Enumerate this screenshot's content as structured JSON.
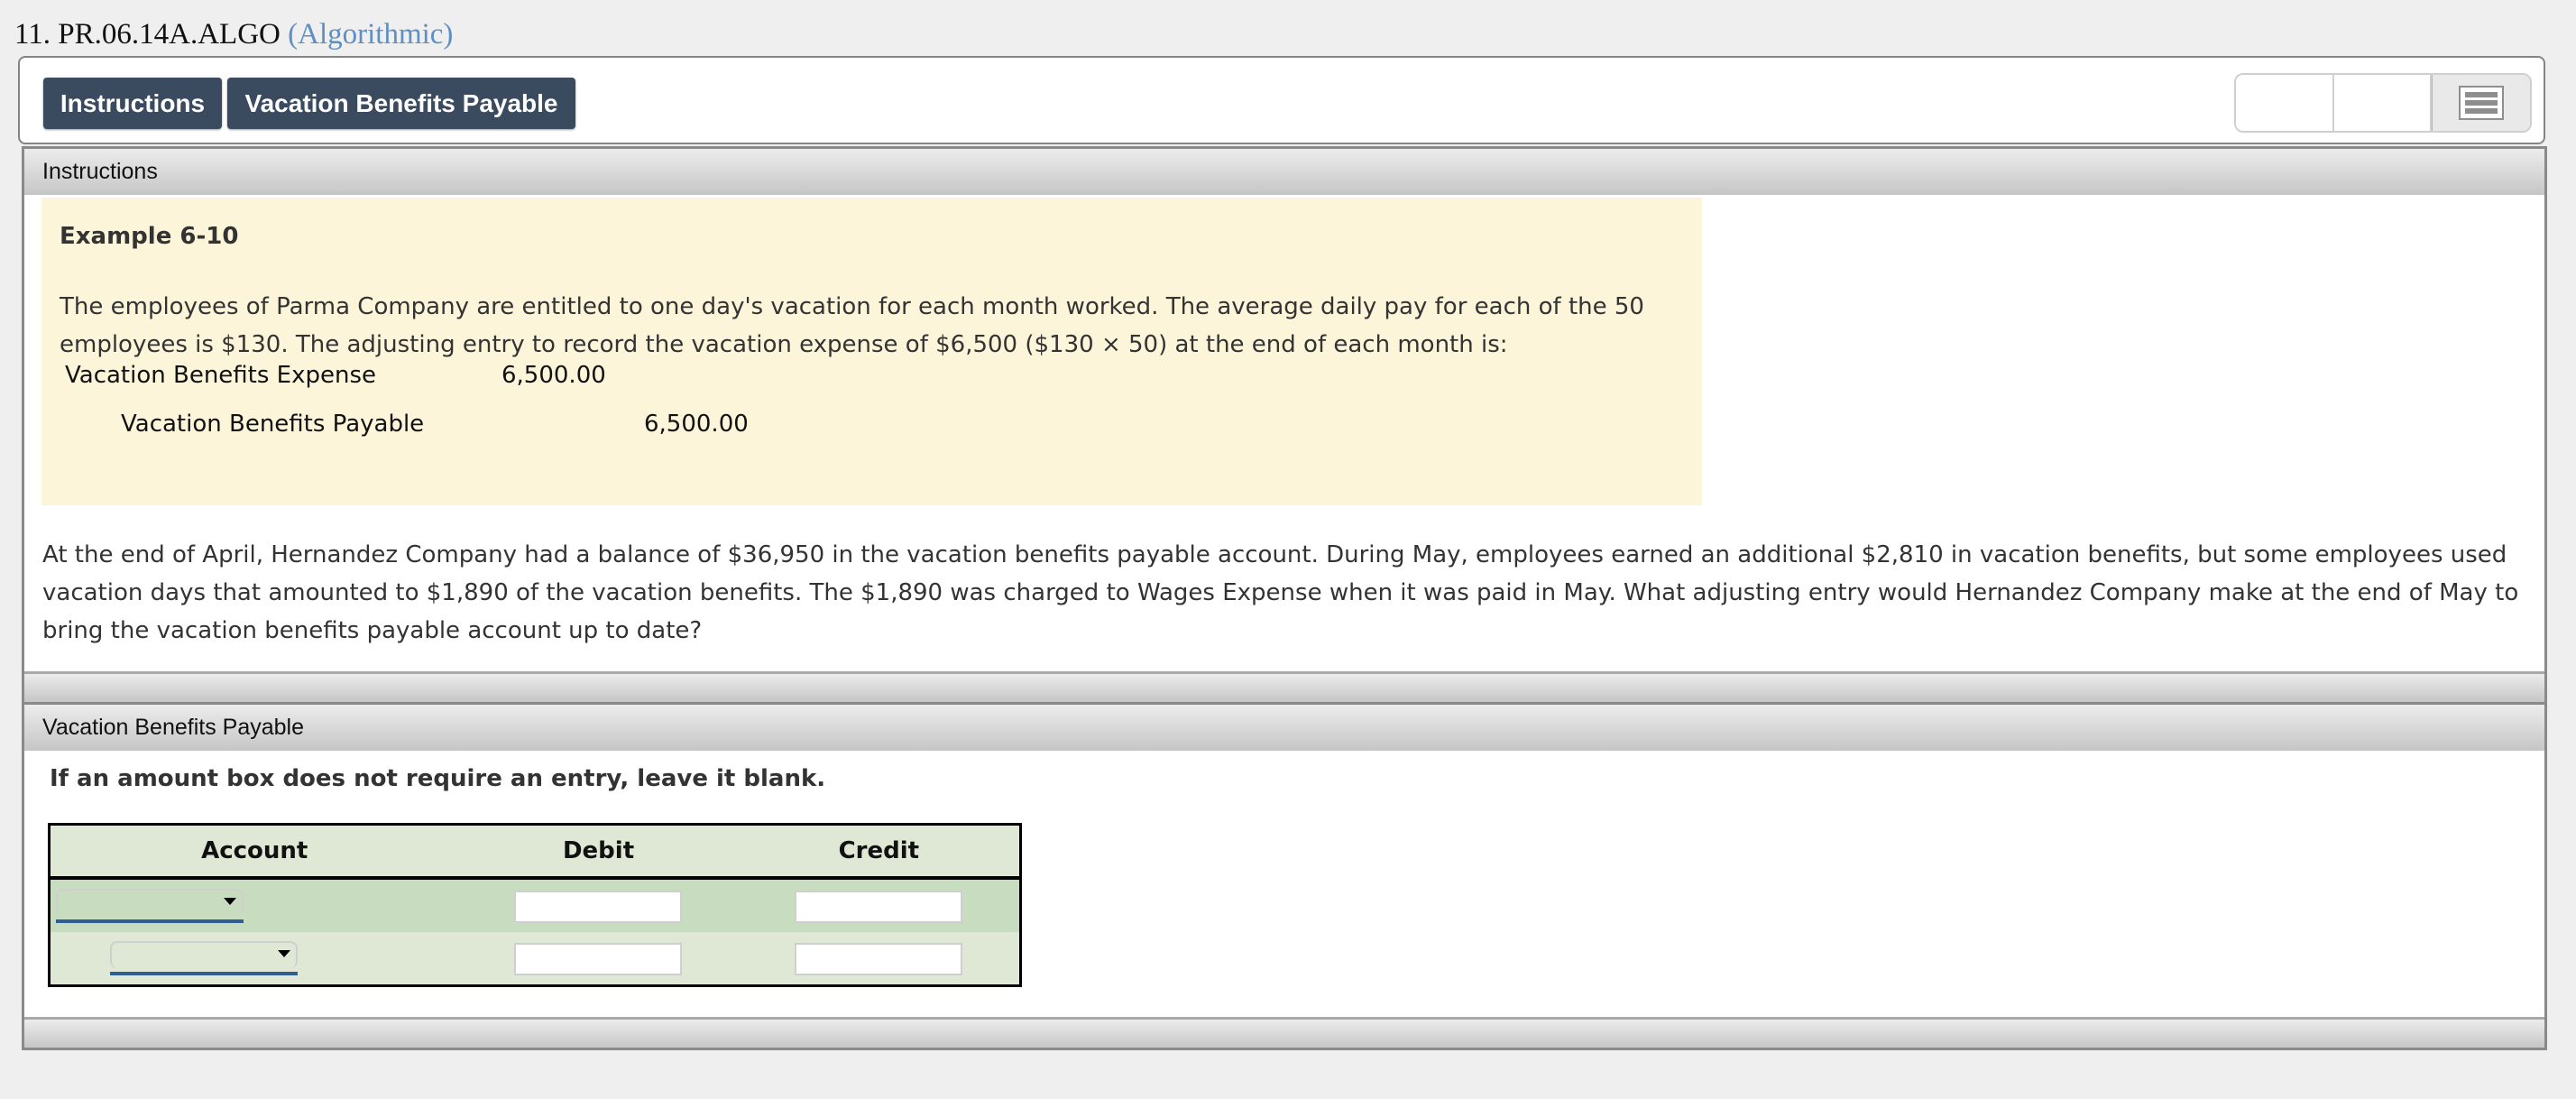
{
  "question": {
    "number_id": "11. PR.06.14A.ALGO",
    "type_label": "(Algorithmic)"
  },
  "tabs": [
    {
      "label": "Instructions"
    },
    {
      "label": "Vacation Benefits Payable"
    }
  ],
  "toolbar": {
    "menu_icon": "hamburger-menu-icon"
  },
  "instructions_panel": {
    "header": "Instructions",
    "example": {
      "title": "Example 6-10",
      "text": "The employees of Parma Company are entitled to one day's vacation for each month worked. The average daily pay for each of the 50 employees is $130. The adjusting entry to record the vacation expense of $6,500 ($130 × 50) at the end of each month is:",
      "entries": [
        {
          "account": "Vacation Benefits Expense",
          "debit": "6,500.00",
          "credit": ""
        },
        {
          "account": "Vacation Benefits Payable",
          "debit": "",
          "credit": "6,500.00"
        }
      ]
    },
    "problem": "At the end of April, Hernandez Company had a balance of $36,950 in the vacation benefits payable account. During May, employees earned an additional $2,810 in vacation benefits, but some employees used vacation days that amounted to $1,890 of the vacation benefits. The $1,890 was charged to Wages Expense when it was paid in May. What adjusting entry would Hernandez Company make at the end of May to bring the vacation benefits payable account up to date?"
  },
  "vbp_panel": {
    "header": "Vacation Benefits Payable",
    "note": "If an amount box does not require an entry, leave it blank.",
    "table": {
      "columns": [
        "Account",
        "Debit",
        "Credit"
      ],
      "rows": [
        {
          "account": "",
          "debit": "",
          "credit": ""
        },
        {
          "account": "",
          "debit": "",
          "credit": ""
        }
      ]
    }
  },
  "colors": {
    "tab_bg": "#3a4a5f",
    "algo_link": "#5e8fc3",
    "example_bg": "#fdf5d9",
    "table_header_bg": "#dfe8d4",
    "table_row1_bg": "#c8dcc0",
    "select_underline": "#2f5f93"
  }
}
